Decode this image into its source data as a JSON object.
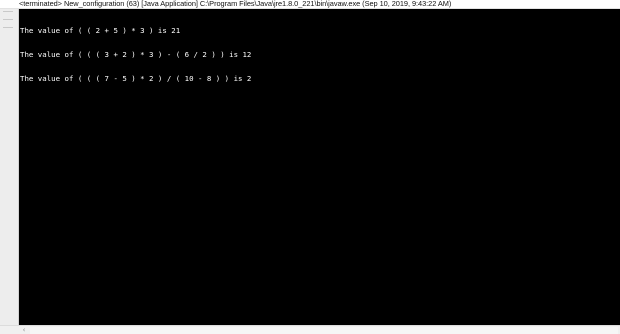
{
  "console": {
    "title": "<terminated> New_configuration (63) [Java Application] C:\\Program Files\\Java\\jre1.8.0_221\\bin\\javaw.exe (Sep 10, 2019, 9:43:22 AM)",
    "lines": [
      "The value of ( ( 2 + 5 ) * 3 ) is 21",
      "The value of ( ( ( 3 + 2 ) * 3 ) - ( 6 / 2 ) ) is 12",
      "The value of ( ( ( 7 - 5 ) * 2 ) / ( 10 - 8 ) ) is 2"
    ]
  },
  "scrollbar": {
    "left_arrow_icon": "chevron-left-icon",
    "left_arrow_glyph": "‹"
  },
  "colors": {
    "console_background": "#000000",
    "console_text": "#ffffff",
    "gutter": "#ededed"
  }
}
